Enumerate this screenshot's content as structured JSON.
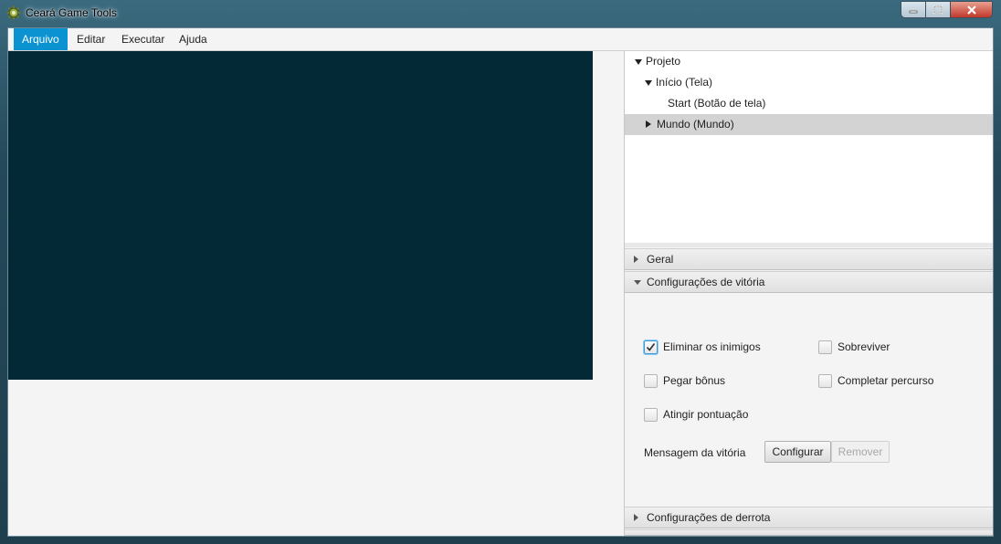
{
  "window": {
    "title": "Ceará Game Tools",
    "controls": [
      "minimize-icon",
      "maximize-icon",
      "close-icon"
    ]
  },
  "menu": {
    "items": [
      {
        "label": "Arquivo",
        "active": true
      },
      {
        "label": "Editar",
        "active": false
      },
      {
        "label": "Executar",
        "active": false
      },
      {
        "label": "Ajuda",
        "active": false
      }
    ]
  },
  "tree": {
    "items": [
      {
        "label": "Projeto",
        "expanded": true,
        "depth": 0
      },
      {
        "label": "Início (Tela)",
        "expanded": true,
        "depth": 1
      },
      {
        "label": "Start (Botão de tela)",
        "leaf": true,
        "depth": 2
      },
      {
        "label": "Mundo (Mundo)",
        "expanded": false,
        "depth": 1,
        "selected": true
      }
    ]
  },
  "accordion": {
    "geral": "Geral",
    "vitoria": "Configurações de vitória",
    "derrota": "Configurações de derrota"
  },
  "victory": {
    "options": [
      {
        "label": "Eliminar os inimigos",
        "checked": true
      },
      {
        "label": "Sobreviver",
        "checked": false
      },
      {
        "label": "Pegar bônus",
        "checked": false
      },
      {
        "label": "Completar percurso",
        "checked": false
      },
      {
        "label": "Atingir pontuação",
        "checked": false
      }
    ],
    "message_label": "Mensagem da vitória",
    "configure_label": "Configurar",
    "remove_label": "Remover"
  },
  "colors": {
    "canvas": "#032937",
    "menu_active": "#0a93d0",
    "selection": "#d3d3d3"
  }
}
